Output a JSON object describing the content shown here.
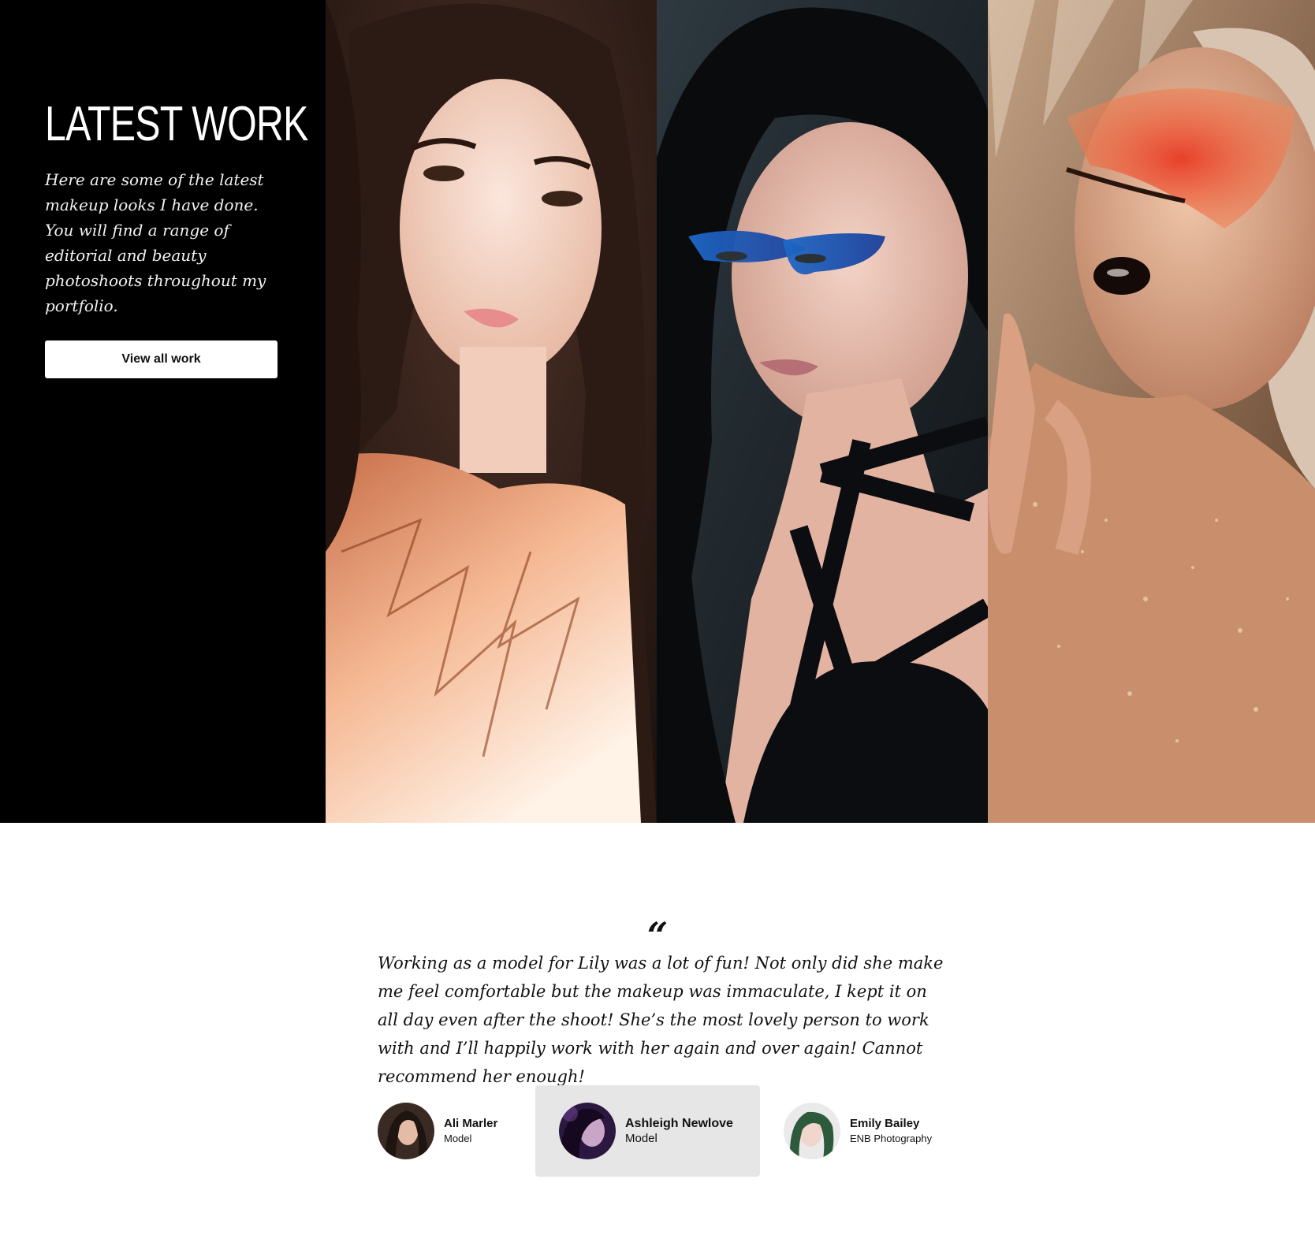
{
  "latest_work": {
    "title": "LATEST WORK",
    "description": "Here are some of the latest makeup looks I have done. You will find a range of editorial and beauty photoshoots throughout my portfolio.",
    "button_label": "View all work"
  },
  "testimonial": {
    "quote_mark": "“",
    "text": "Working as a model for Lily was a lot of fun! Not only did she make me feel comfortable but the makeup was immaculate, I kept it on all day even after the shoot! She’s the most lovely person to work with and I’ll happily work with her again and over again! Cannot recommend her enough!",
    "people": [
      {
        "name": "Ali Marler",
        "role": "Model"
      },
      {
        "name": "Ashleigh Newlove",
        "role": "Model",
        "active": true
      },
      {
        "name": "Emily Bailey",
        "role": "ENB Photography"
      }
    ]
  },
  "colors": {
    "hero_background": "#000000",
    "active_person_background": "#e6e6e6"
  }
}
